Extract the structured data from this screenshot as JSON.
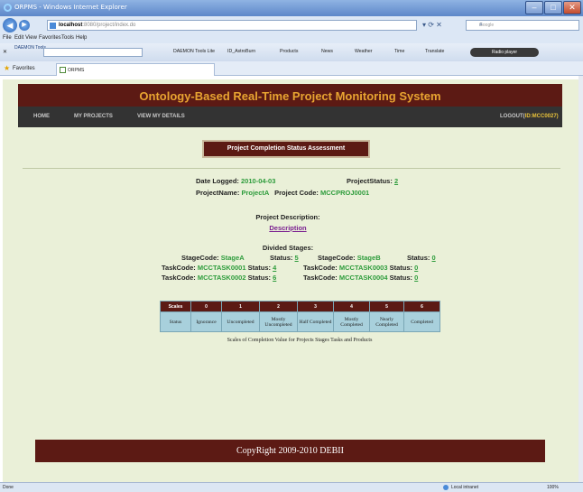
{
  "browser": {
    "window_title": "ORPMS - Windows Internet Explorer",
    "url_host": "localhost",
    "url_rest": ":8080/project/index.do",
    "search_placeholder": "Google",
    "menu": [
      "File",
      "Edit",
      "View",
      "Favorites",
      "Tools",
      "Help"
    ],
    "toolbar": {
      "daemon_brand": "DAEMON Tools",
      "links": [
        "DAEMON Tools Lite",
        "ID_AstroBurn",
        "Products",
        "News",
        "Weather",
        "Time",
        "Translate"
      ],
      "radio_label": "Radio player"
    },
    "favorites_label": "Favorites",
    "tab_title": "ORPMS"
  },
  "app": {
    "title": "Ontology-Based Real-Time Project Monitoring System",
    "nav": {
      "home": "HOME",
      "my_projects": "MY PROJECTS",
      "view_details": "VIEW MY DETAILS",
      "logout": "LOGOUT(",
      "user_id": "ID:MCC0027)"
    },
    "section_title": "Project Completion Status Assessment"
  },
  "project": {
    "date_logged_label": "Date Logged:",
    "date_logged": "2010-04-03",
    "status_label": "ProjectStatus:",
    "status": "2",
    "name_label": "ProjectName:",
    "name": "ProjectA",
    "code_label": "Project Code:",
    "code": "MCCPROJ0001",
    "description_label": "Project Description:",
    "description_link": "Description",
    "divided_stages_label": "Divided Stages:",
    "stage_code_label": "StageCode:",
    "status_field_label": "Status:",
    "task_code_label": "TaskCode:",
    "stages": [
      {
        "code": "StageA",
        "status": "5"
      },
      {
        "code": "StageB",
        "status": "0"
      }
    ],
    "tasks": [
      {
        "code": "MCCTASK0001",
        "status": "4"
      },
      {
        "code": "MCCTASK0003",
        "status": "0"
      },
      {
        "code": "MCCTASK0002",
        "status": "6"
      },
      {
        "code": "MCCTASK0004",
        "status": "0"
      }
    ]
  },
  "scales_table": {
    "header_label": "Scales",
    "row_label": "Status",
    "scale_values": [
      "0",
      "1",
      "2",
      "3",
      "4",
      "5",
      "6"
    ],
    "status_values": [
      "Ignorance",
      "Uncompleted",
      "Mostly Uncompleted",
      "Half Completed",
      "Mostly Completed",
      "Nearly Completed",
      "Completed"
    ],
    "caption": "Scales of Completion Value for Projects Stages Tasks and Products"
  },
  "footer": "CopyRight 2009-2010 DEBII",
  "statusbar": {
    "left": "Done",
    "zone": "Local intranet",
    "zoom": "100%"
  }
}
